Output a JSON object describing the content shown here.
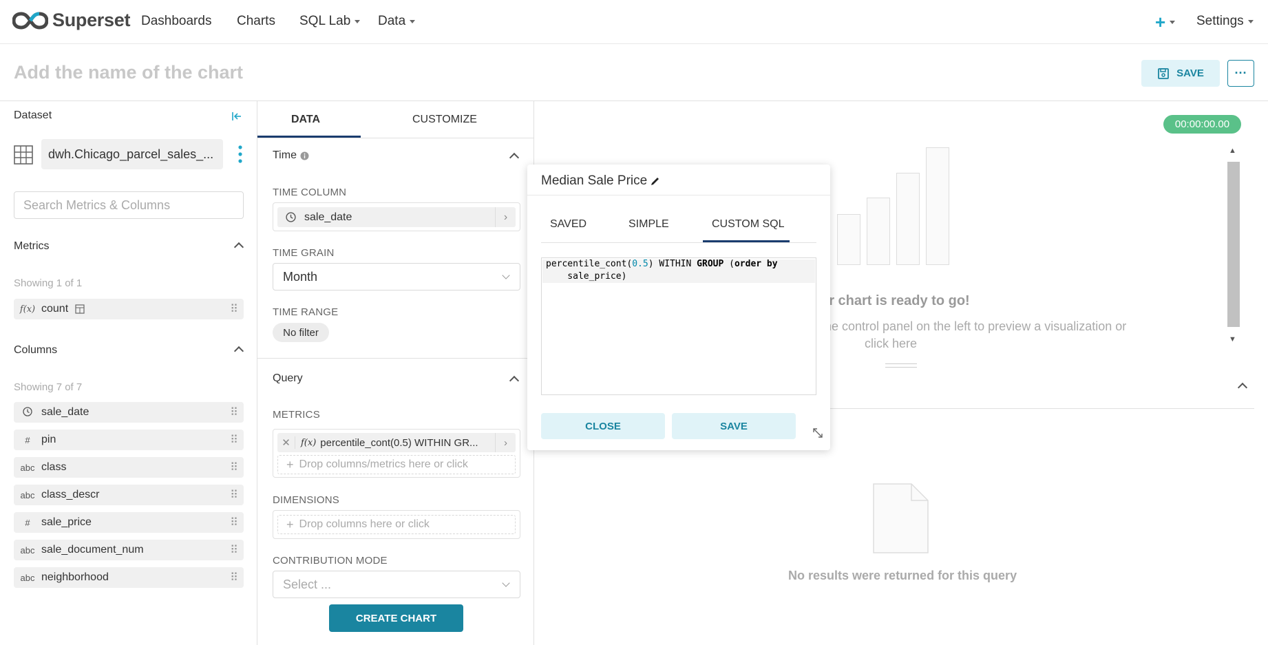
{
  "nav": {
    "brand": "Superset",
    "items": [
      {
        "label": "Dashboards"
      },
      {
        "label": "Charts"
      },
      {
        "label": "SQL Lab"
      },
      {
        "label": "Data"
      }
    ],
    "plus_label": "+",
    "settings_label": "Settings"
  },
  "header": {
    "chart_name_placeholder": "Add the name of the chart",
    "save_label": "SAVE",
    "more_label": "···"
  },
  "dataset": {
    "heading": "Dataset",
    "name": "dwh.Chicago_parcel_sales_...",
    "search_placeholder": "Search Metrics & Columns",
    "metrics_heading": "Metrics",
    "metrics_count": "Showing 1 of 1",
    "metrics": [
      {
        "type": "f(x)",
        "name": "count"
      }
    ],
    "columns_heading": "Columns",
    "columns_count": "Showing 7 of 7",
    "columns": [
      {
        "type": "clock",
        "name": "sale_date"
      },
      {
        "type": "#",
        "name": "pin"
      },
      {
        "type": "abc",
        "name": "class"
      },
      {
        "type": "abc",
        "name": "class_descr"
      },
      {
        "type": "#",
        "name": "sale_price"
      },
      {
        "type": "abc",
        "name": "sale_document_num"
      },
      {
        "type": "abc",
        "name": "neighborhood"
      }
    ]
  },
  "control": {
    "tabs": [
      {
        "label": "DATA"
      },
      {
        "label": "CUSTOMIZE"
      }
    ],
    "time_section": "Time",
    "time_column_label": "TIME COLUMN",
    "time_column_value": "sale_date",
    "time_grain_label": "TIME GRAIN",
    "time_grain_value": "Month",
    "time_range_label": "TIME RANGE",
    "time_range_value": "No filter",
    "query_section": "Query",
    "metrics_label": "METRICS",
    "metric_value": "percentile_cont(0.5) WITHIN GR...",
    "metrics_drop": "Drop columns/metrics here or click",
    "dimensions_label": "DIMENSIONS",
    "dimensions_drop": "Drop columns here or click",
    "contribution_label": "CONTRIBUTION MODE",
    "contribution_placeholder": "Select ...",
    "create_chart": "CREATE CHART"
  },
  "chart_area": {
    "timer": "00:00:00.00",
    "ready_title": "ur chart is ready to go!",
    "ready_sub": "the control panel on the left to preview a visualization or",
    "ready_sub2": "click here",
    "no_results": "No results were returned for this query"
  },
  "popover": {
    "title": "Median Sale Price",
    "tabs": [
      {
        "label": "SAVED"
      },
      {
        "label": "SIMPLE"
      },
      {
        "label": "CUSTOM SQL"
      }
    ],
    "active_tab": "CUSTOM SQL",
    "sql_line1_a": "percentile_cont(",
    "sql_line1_num": "0.5",
    "sql_line1_b": ") WITHIN ",
    "sql_line1_kw1": "GROUP",
    "sql_line1_c": " (",
    "sql_line1_kw2": "order by",
    "sql_line2": "    sale_price)",
    "close_label": "CLOSE",
    "save_label": "SAVE"
  },
  "colors": {
    "accent": "#1a85a0",
    "nav_plus": "#20a7c9",
    "timer_bg": "#5ac189",
    "tab_underline": "#1a3c6e"
  }
}
